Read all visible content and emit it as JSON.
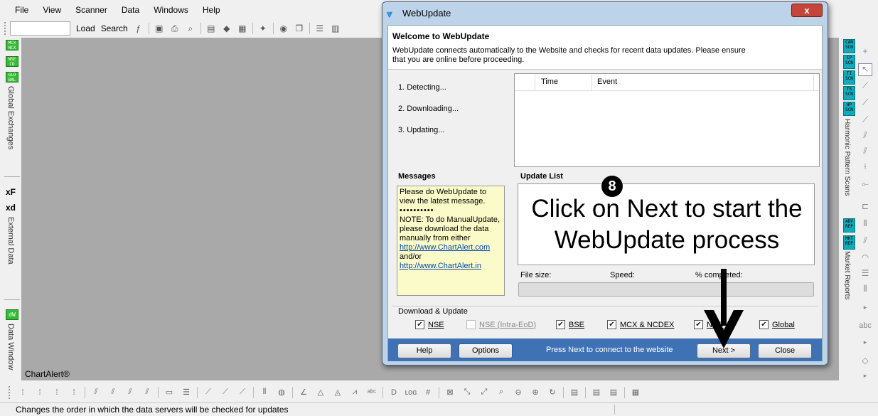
{
  "menu": [
    "File",
    "View",
    "Scanner",
    "Data",
    "Windows",
    "Help"
  ],
  "toolbar": {
    "load": "Load",
    "search": "Search"
  },
  "left_panel": {
    "badges": [
      "MCX NCX",
      "NSE CD",
      "GLO BAL"
    ],
    "global_exchanges": "Global Exchanges",
    "external_data": "External Data",
    "data_window": "Data Window",
    "xf": "xF",
    "xd": "xd",
    "dw": "dW"
  },
  "right_panel": {
    "badges": [
      "CAN SCN",
      "CP SCN",
      "TI SCN",
      "TS SCN",
      "HP SCN"
    ],
    "harmonic": "Harmonic Pattern Scans",
    "report_badges": [
      "ADV REP",
      "MKT REP"
    ],
    "market_reports": "Market Reports",
    "abc": "abc"
  },
  "mdi": {
    "watermark": "ChartAlert®"
  },
  "dialog": {
    "title": "WebUpdate",
    "close": "x",
    "heading": "Welcome to WebUpdate",
    "description": "WebUpdate connects automatically to the Website and checks for recent data updates. Please ensure that you are online before proceeding.",
    "steps": [
      "1. Detecting...",
      "2. Downloading...",
      "3. Updating..."
    ],
    "columns": {
      "time": "Time",
      "event": "Event"
    },
    "messages": {
      "label": "Messages",
      "line1": "Please do WebUpdate to view the latest message.",
      "dots": "••••••••••",
      "line2": "NOTE: To do ManualUpdate, please download the data manually from either",
      "link1": "http://www.ChartAlert.com",
      "andor": "and/or",
      "link2": "http://www.ChartAlert.in"
    },
    "update_list_label": "Update List",
    "file_size": "File size:",
    "speed": "Speed:",
    "completed": "% completed:",
    "download_group": "Download & Update",
    "checkboxes": [
      {
        "label": "NSE",
        "checked": true,
        "enabled": true
      },
      {
        "label": "NSE (Intra-EoD)",
        "checked": false,
        "enabled": false
      },
      {
        "label": "BSE",
        "checked": true,
        "enabled": true
      },
      {
        "label": "MCX & NCDEX",
        "checked": true,
        "enabled": true
      },
      {
        "label": "NCD",
        "checked": true,
        "enabled": true
      },
      {
        "label": "Global",
        "checked": true,
        "enabled": true
      }
    ],
    "footer": {
      "help": "Help",
      "options": "Options",
      "message": "Press Next to connect to the website",
      "next": "Next >",
      "close": "Close"
    }
  },
  "overlay": {
    "step_number": "8",
    "instruction": "Click on Next to start the WebUpdate process"
  },
  "status": {
    "text": "Changes the order in which the data servers will be checked for updates"
  }
}
